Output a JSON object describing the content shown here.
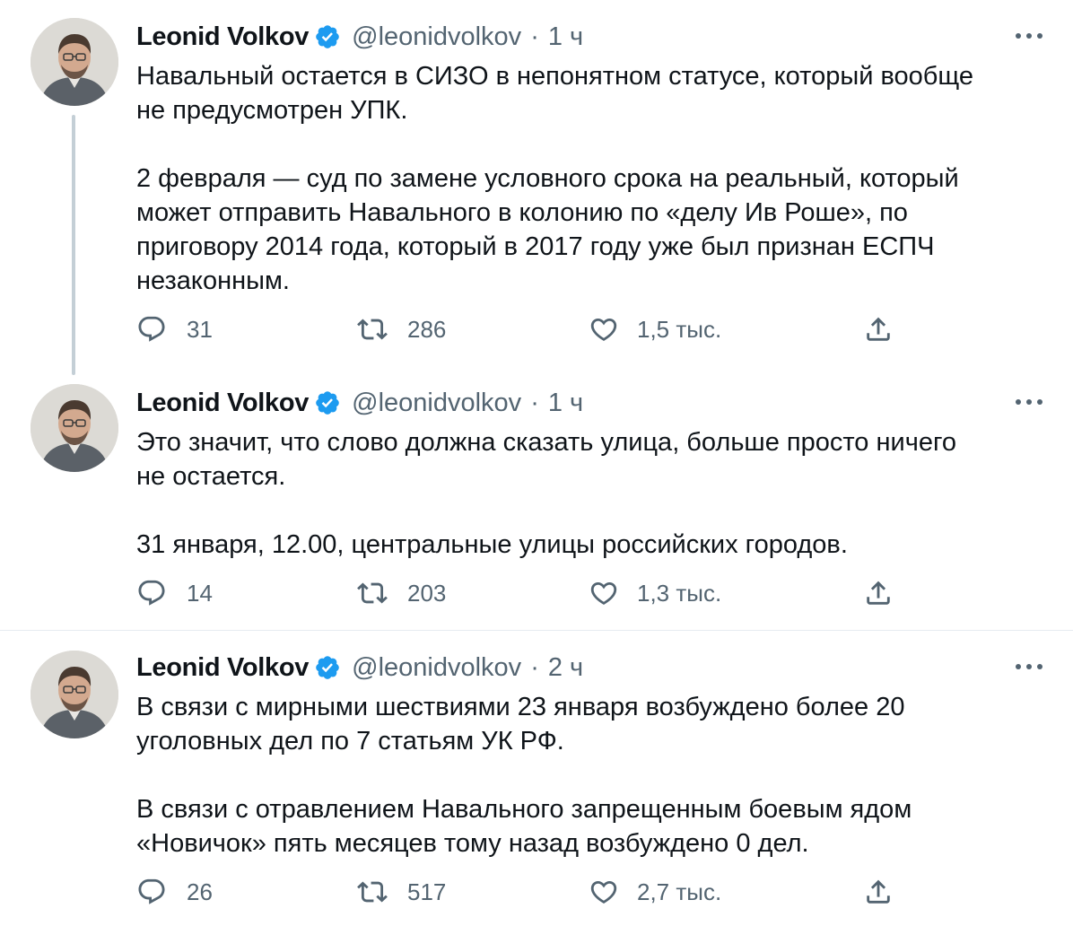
{
  "tweets": [
    {
      "author_name": "Leonid Volkov",
      "handle": "@leonidvolkov",
      "separator": "·",
      "time": "1 ч",
      "text": "Навальный остается в СИЗО в непонятном статусе, который вообще\nне предусмотрен УПК.\n\n2 февраля — суд по замене условного срока на реальный, который\nможет отправить Навального в колонию по «делу Ив Роше», по\nприговору 2014 года, который в 2017 году уже был признан ЕСПЧ\nнезаконным.",
      "replies": "31",
      "retweets": "286",
      "likes": "1,5 тыс."
    },
    {
      "author_name": "Leonid Volkov",
      "handle": "@leonidvolkov",
      "separator": "·",
      "time": "1 ч",
      "text": "Это значит, что слово должна сказать улица, больше просто ничего\nне остается.\n\n31 января, 12.00, центральные улицы российских городов.",
      "replies": "14",
      "retweets": "203",
      "likes": "1,3 тыс."
    },
    {
      "author_name": "Leonid Volkov",
      "handle": "@leonidvolkov",
      "separator": "·",
      "time": "2 ч",
      "text": "В связи с мирными шествиями 23 января возбуждено более 20\nуголовных дел по 7 статьям УК РФ.\n\nВ связи с отравлением Навального запрещенным боевым ядом\n«Новичок» пять месяцев тому назад возбуждено 0 дел.",
      "replies": "26",
      "retweets": "517",
      "likes": "2,7 тыс."
    }
  ],
  "colors": {
    "text": "#0f1419",
    "secondary": "#536471",
    "verified": "#1d9bf0",
    "thread_line": "#c4cfd6",
    "divider": "#e6ecf0"
  },
  "icons": [
    "verified-badge-icon",
    "more-icon",
    "reply-icon",
    "retweet-icon",
    "like-icon",
    "share-icon"
  ]
}
